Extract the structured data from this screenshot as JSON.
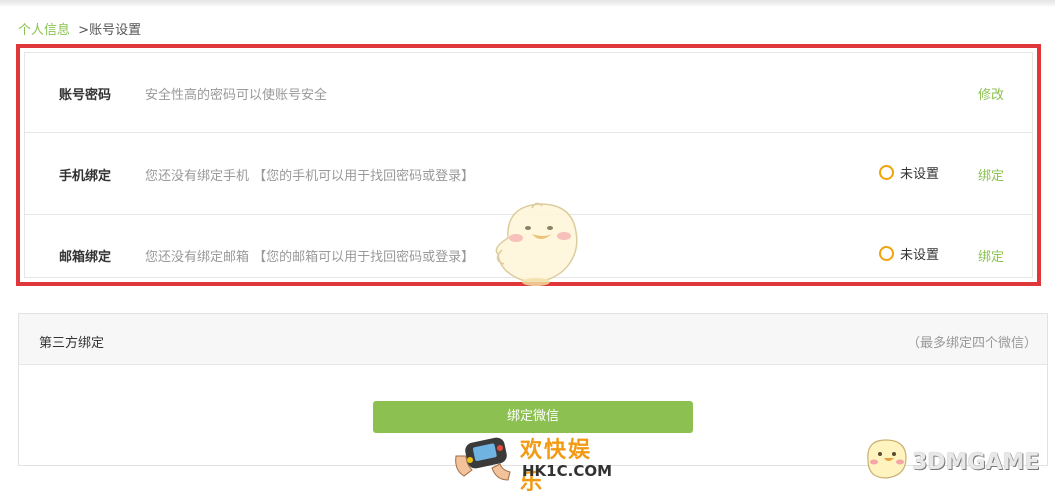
{
  "breadcrumb": {
    "parent": "个人信息",
    "separator": ">",
    "current": "账号设置"
  },
  "account_rows": [
    {
      "label": "账号密码",
      "desc": "安全性高的密码可以使账号安全",
      "status": "",
      "action": "修改"
    },
    {
      "label": "手机绑定",
      "desc": "您还没有绑定手机 【您的手机可以用于找回密码或登录】",
      "status": "未设置",
      "action": "绑定"
    },
    {
      "label": "邮箱绑定",
      "desc": "您还没有绑定邮箱 【您的邮箱可以用于找回密码或登录】",
      "status": "未设置",
      "action": "绑定"
    }
  ],
  "third_party": {
    "title": "第三方绑定",
    "note": "（最多绑定四个微信）",
    "button": "绑定微信"
  },
  "watermarks": {
    "hk_cn": "欢快娱乐",
    "hk_en": "HK1C.COM",
    "dm": "3DMGAME"
  },
  "colors": {
    "accent_green": "#8cc152",
    "highlight_red": "#e0373b",
    "status_orange": "#f0a30a"
  },
  "icons": {
    "status": "circle-outline-icon"
  }
}
